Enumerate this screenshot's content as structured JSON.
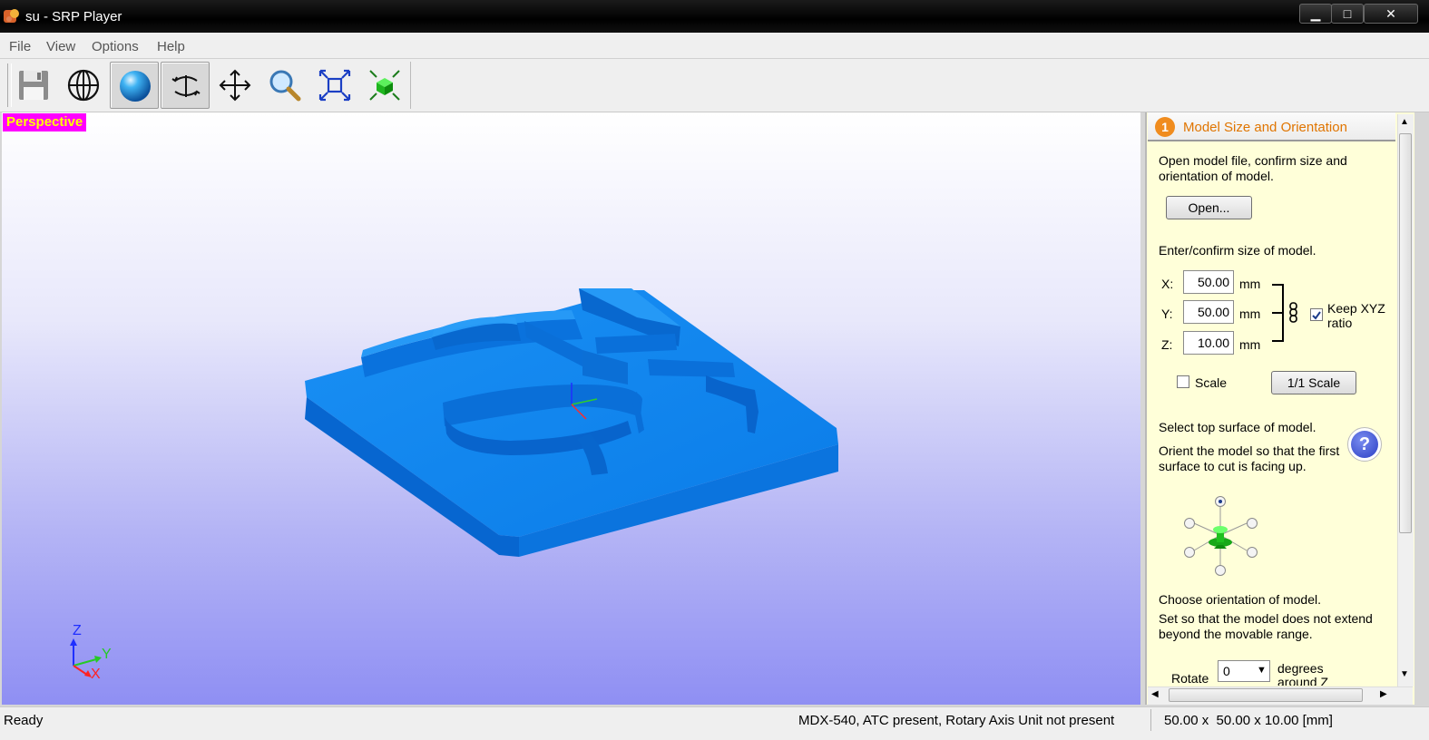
{
  "window": {
    "title": "su - SRP Player",
    "controls": {
      "minimize": "▁",
      "maximize": "□",
      "close": "✕"
    }
  },
  "menu": [
    "File",
    "View",
    "Options",
    "Help"
  ],
  "toolbar": {
    "buttons": [
      {
        "name": "save-icon",
        "active": false
      },
      {
        "name": "wireframe-globe-icon",
        "active": false
      },
      {
        "name": "shaded-sphere-icon",
        "active": true
      },
      {
        "name": "rotate-icon",
        "active": true
      },
      {
        "name": "pan-icon",
        "active": false
      },
      {
        "name": "zoom-icon",
        "active": false
      },
      {
        "name": "fit-view-icon",
        "active": false
      },
      {
        "name": "fit-model-icon",
        "active": false
      }
    ]
  },
  "viewport": {
    "view_label": "Perspective",
    "axis_labels": {
      "z": "Z",
      "y": "Y",
      "x": "X"
    },
    "colors": {
      "model": "#0a84ee",
      "label_bg": "#ff00ff",
      "label_text": "#ffff00"
    }
  },
  "panel": {
    "step_number": "1",
    "title": "Model Size and Orientation",
    "open_hint": "Open model file, confirm size and orientation of model.",
    "open_button": "Open...",
    "size_hint": "Enter/confirm size of model.",
    "x_label": "X:",
    "x_value": "50.00",
    "x_unit": "mm",
    "y_label": "Y:",
    "y_value": "50.00",
    "y_unit": "mm",
    "z_label": "Z:",
    "z_value": "10.00",
    "z_unit": "mm",
    "keep_ratio_label": "Keep XYZ ratio",
    "keep_ratio_checked": true,
    "scale_label": "Scale",
    "scale_checked": false,
    "one_to_one_button": "1/1 Scale",
    "top_surface_title": "Select top surface of model.",
    "top_surface_hint": "Orient the model so that the first surface to cut is facing up.",
    "help_icon": "?",
    "orientation_title": "Choose orientation of model.",
    "orientation_hint": "Set so that the model does not extend beyond the movable range.",
    "rotate_label": "Rotate",
    "rotate_value": "0",
    "degrees_label": "degrees around Z axis"
  },
  "status": {
    "state": "Ready",
    "machine": "MDX-540, ATC present, Rotary Axis Unit not present",
    "dimensions": "50.00 x  50.00 x 10.00 [mm]"
  }
}
